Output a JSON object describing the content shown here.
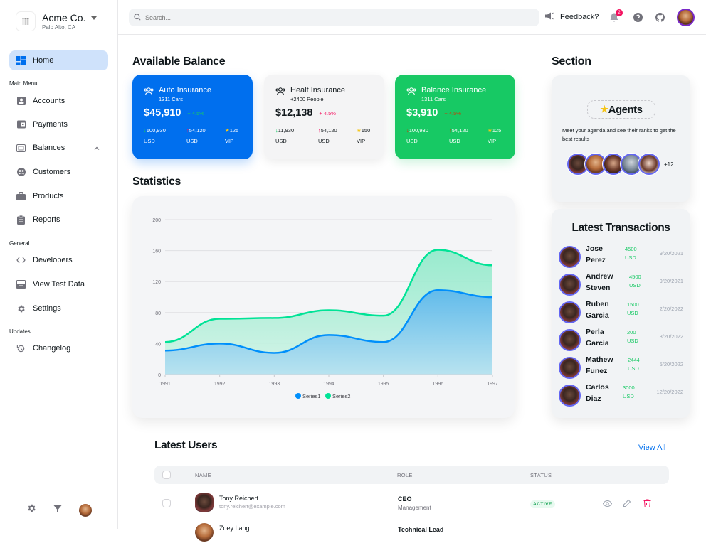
{
  "brand": {
    "name": "Acme Co.",
    "location": "Palo Alto, CA"
  },
  "sidebar": {
    "home": {
      "label": "Home",
      "icon": "dashboard-icon",
      "active": true
    },
    "sections": [
      {
        "title": "Main Menu",
        "items": [
          {
            "label": "Accounts",
            "icon": "account-icon"
          },
          {
            "label": "Payments",
            "icon": "wallet-icon"
          },
          {
            "label": "Balances",
            "icon": "balance-icon",
            "expandable": true
          },
          {
            "label": "Customers",
            "icon": "customers-icon"
          },
          {
            "label": "Products",
            "icon": "briefcase-icon"
          },
          {
            "label": "Reports",
            "icon": "clipboard-icon"
          }
        ]
      },
      {
        "title": "General",
        "items": [
          {
            "label": "Developers",
            "icon": "code-icon"
          },
          {
            "label": "View Test Data",
            "icon": "test-data-icon"
          },
          {
            "label": "Settings",
            "icon": "gear-icon"
          }
        ]
      },
      {
        "title": "Updates",
        "items": [
          {
            "label": "Changelog",
            "icon": "history-icon"
          }
        ]
      }
    ]
  },
  "topbar": {
    "search_placeholder": "Search...",
    "feedback_label": "Feedback?",
    "notification_count": "2"
  },
  "balance": {
    "title": "Available Balance",
    "cards": [
      {
        "title": "Auto Insurance",
        "subtitle": "1311 Cars",
        "amount": "$45,910",
        "change": "+ 4.5%",
        "stats": [
          {
            "value": "100,930",
            "unit": "USD",
            "dir": "down"
          },
          {
            "value": "54,120",
            "unit": "USD",
            "dir": "up"
          },
          {
            "value": "125",
            "unit": "VIP",
            "dir": "star"
          }
        ]
      },
      {
        "title": "Healt Insurance",
        "subtitle": "+2400 People",
        "amount": "$12,138",
        "change": "+ 4.5%",
        "stats": [
          {
            "value": "11,930",
            "unit": "USD",
            "dir": "down"
          },
          {
            "value": "54,120",
            "unit": "USD",
            "dir": "up"
          },
          {
            "value": "150",
            "unit": "VIP",
            "dir": "star"
          }
        ]
      },
      {
        "title": "Balance Insurance",
        "subtitle": "1311 Cars",
        "amount": "$3,910",
        "change": "+ 4.5%",
        "stats": [
          {
            "value": "100,930",
            "unit": "USD",
            "dir": "down"
          },
          {
            "value": "54,120",
            "unit": "USD",
            "dir": "up"
          },
          {
            "value": "125",
            "unit": "VIP",
            "dir": "star"
          }
        ]
      }
    ]
  },
  "statistics": {
    "title": "Statistics"
  },
  "chart_data": {
    "type": "area",
    "title": "",
    "x": [
      "1991",
      "1992",
      "1993",
      "1994",
      "1995",
      "1996",
      "1997"
    ],
    "series": [
      {
        "name": "Series1",
        "color": "#008ffb",
        "values": [
          31,
          40,
          28,
          51,
          42,
          109,
          100
        ]
      },
      {
        "name": "Series2",
        "color": "#00e396",
        "values": [
          11,
          32,
          45,
          32,
          34,
          52,
          41
        ]
      }
    ],
    "stacked": true,
    "yticks": [
      "0",
      "40",
      "80",
      "120",
      "160",
      "200"
    ],
    "ylim": [
      0,
      200
    ],
    "grid": true,
    "legend": "bottom-center"
  },
  "section": {
    "title": "Section",
    "agents_label": "Agents",
    "description": "Meet your agenda and see their ranks to get the best results",
    "more_count": "+12"
  },
  "transactions": {
    "title": "Latest Transactions",
    "items": [
      {
        "first": "Jose",
        "last": "Perez",
        "amount": "4500",
        "currency": "USD",
        "date": "9/20/2021"
      },
      {
        "first": "Andrew",
        "last": "Steven",
        "amount": "4500",
        "currency": "USD",
        "date": "9/20/2021"
      },
      {
        "first": "Ruben",
        "last": "Garcia",
        "amount": "1500",
        "currency": "USD",
        "date": "2/20/2022"
      },
      {
        "first": "Perla",
        "last": "Garcia",
        "amount": "200",
        "currency": "USD",
        "date": "3/20/2022"
      },
      {
        "first": "Mathew",
        "last": "Funez",
        "amount": "2444",
        "currency": "USD",
        "date": "5/20/2022"
      },
      {
        "first": "Carlos",
        "last": "Diaz",
        "amount": "3000",
        "currency": "USD",
        "date": "12/20/2022"
      }
    ]
  },
  "users": {
    "title": "Latest Users",
    "view_all": "View All",
    "columns": [
      "NAME",
      "ROLE",
      "STATUS"
    ],
    "rows": [
      {
        "name": "Tony Reichert",
        "email": "tony.reichert@example.com",
        "role": "CEO",
        "department": "Management",
        "status": "ACTIVE"
      },
      {
        "name": "Zoey Lang",
        "email": "",
        "role": "Technical Lead",
        "department": "",
        "status": ""
      }
    ]
  },
  "colors": {
    "primary": "#006fee",
    "success": "#17c964",
    "danger": "#f31260",
    "series1": "#008ffb",
    "series2": "#00e396"
  }
}
